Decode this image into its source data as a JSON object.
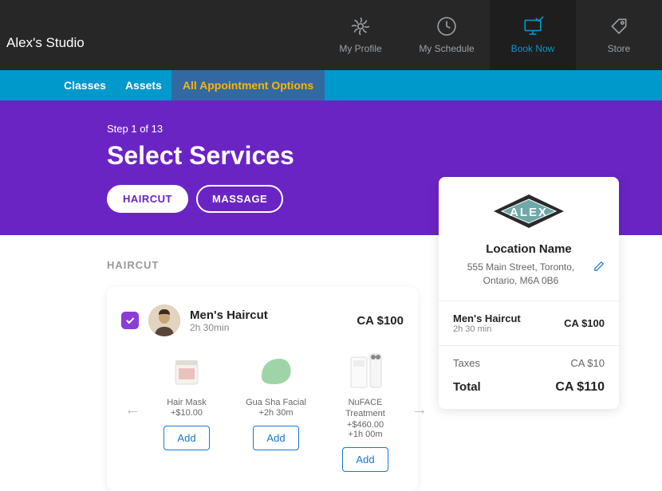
{
  "header": {
    "studio_name": "Alex's Studio",
    "nav": [
      {
        "label": "My Profile"
      },
      {
        "label": "My Schedule"
      },
      {
        "label": "Book Now"
      },
      {
        "label": "Store"
      }
    ]
  },
  "tabs": [
    {
      "label": "Classes"
    },
    {
      "label": "Assets"
    },
    {
      "label": "All Appointment Options"
    }
  ],
  "hero": {
    "step": "Step 1 of 13",
    "title": "Select Services",
    "pills": [
      {
        "label": "HAIRCUT"
      },
      {
        "label": "MASSAGE"
      }
    ]
  },
  "section_label": "HAIRCUT",
  "service": {
    "name": "Men's Haircut",
    "duration": "2h 30min",
    "price": "CA $100"
  },
  "addons": [
    {
      "name": "Hair Mask",
      "price": "+$10.00",
      "duration": "",
      "add_label": "Add",
      "icon": "jar"
    },
    {
      "name": "Gua Sha Facial",
      "price": "+2h 30m",
      "duration": "",
      "add_label": "Add",
      "icon": "guasha"
    },
    {
      "name": "NuFACE Treatment",
      "price": "+$460.00",
      "duration": "+1h 00m",
      "add_label": "Add",
      "icon": "device"
    }
  ],
  "summary": {
    "logo_text": "ALEX",
    "location_name": "Location Name",
    "address": "555 Main Street, Toronto, Ontario, M6A 0B6",
    "lines": [
      {
        "name": "Men's Haircut",
        "sub": "2h 30 min",
        "amount": "CA $100"
      }
    ],
    "tax_label": "Taxes",
    "tax_amount": "CA $10",
    "total_label": "Total",
    "total_amount": "CA $110"
  }
}
